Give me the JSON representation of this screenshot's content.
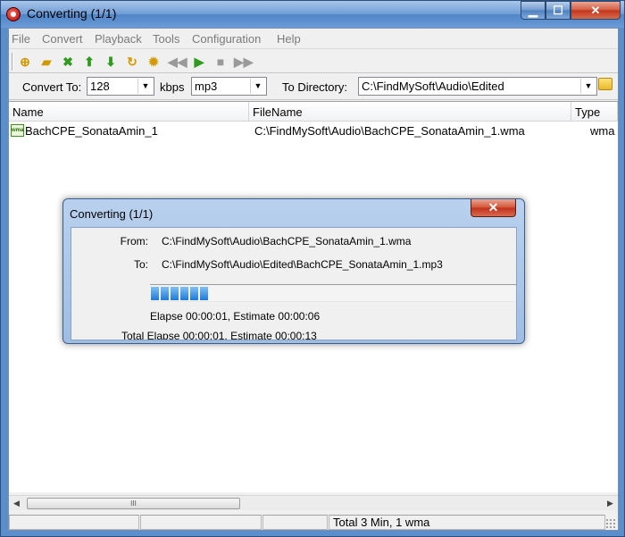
{
  "window": {
    "title": "Converting (1/1)"
  },
  "menu": [
    "File",
    "Convert",
    "Playback",
    "Tools",
    "Configuration",
    "Help"
  ],
  "options": {
    "convert_to_label": "Convert To:",
    "bitrate": "128",
    "kbps_label": "kbps",
    "format": "mp3",
    "to_directory_label": "To Directory:",
    "directory": "C:\\FindMySoft\\Audio\\Edited"
  },
  "list": {
    "headers": {
      "name": "Name",
      "filename": "FileName",
      "type": "Type"
    },
    "rows": [
      {
        "name": "BachCPE_SonataAmin_1",
        "filename": "C:\\FindMySoft\\Audio\\BachCPE_SonataAmin_1.wma",
        "type": "wma",
        "icon_text": "wma"
      }
    ]
  },
  "scrollbar": {
    "thumb_grip": "III"
  },
  "status": {
    "summary": "Total 3 Min, 1 wma"
  },
  "dialog": {
    "title": "Converting (1/1)",
    "from_label": "From:",
    "from_value": "C:\\FindMySoft\\Audio\\BachCPE_SonataAmin_1.wma",
    "to_label": "To:",
    "to_value": "C:\\FindMySoft\\Audio\\Edited\\BachCPE_SonataAmin_1.mp3",
    "progress_blocks": 6,
    "elapse_text": "Elapse 00:00:01, Estimate 00:00:06",
    "total_text": "Total Elapse 00:00:01, Estimate 00:00:13"
  },
  "icons": {
    "toolbar": [
      "add-files-icon",
      "open-folder-icon",
      "remove-icon",
      "move-up-icon",
      "move-down-icon",
      "convert-icon",
      "settings-icon",
      "rewind-icon",
      "play-icon",
      "stop-icon",
      "fast-forward-icon"
    ]
  },
  "colors": {
    "titlebar": "#5b8fcb",
    "progress": "#1f7ad8",
    "close_button": "#c1301a"
  }
}
